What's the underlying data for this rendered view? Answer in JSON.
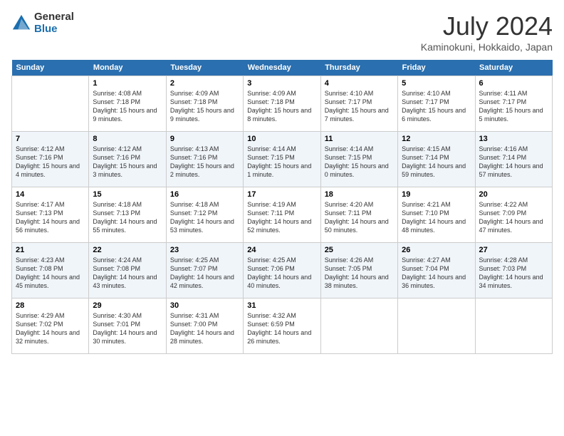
{
  "header": {
    "logo_general": "General",
    "logo_blue": "Blue",
    "month_title": "July 2024",
    "location": "Kaminokuni, Hokkaido, Japan"
  },
  "days_of_week": [
    "Sunday",
    "Monday",
    "Tuesday",
    "Wednesday",
    "Thursday",
    "Friday",
    "Saturday"
  ],
  "weeks": [
    [
      {
        "day": "",
        "sunrise": "",
        "sunset": "",
        "daylight": ""
      },
      {
        "day": "1",
        "sunrise": "Sunrise: 4:08 AM",
        "sunset": "Sunset: 7:18 PM",
        "daylight": "Daylight: 15 hours and 9 minutes."
      },
      {
        "day": "2",
        "sunrise": "Sunrise: 4:09 AM",
        "sunset": "Sunset: 7:18 PM",
        "daylight": "Daylight: 15 hours and 9 minutes."
      },
      {
        "day": "3",
        "sunrise": "Sunrise: 4:09 AM",
        "sunset": "Sunset: 7:18 PM",
        "daylight": "Daylight: 15 hours and 8 minutes."
      },
      {
        "day": "4",
        "sunrise": "Sunrise: 4:10 AM",
        "sunset": "Sunset: 7:17 PM",
        "daylight": "Daylight: 15 hours and 7 minutes."
      },
      {
        "day": "5",
        "sunrise": "Sunrise: 4:10 AM",
        "sunset": "Sunset: 7:17 PM",
        "daylight": "Daylight: 15 hours and 6 minutes."
      },
      {
        "day": "6",
        "sunrise": "Sunrise: 4:11 AM",
        "sunset": "Sunset: 7:17 PM",
        "daylight": "Daylight: 15 hours and 5 minutes."
      }
    ],
    [
      {
        "day": "7",
        "sunrise": "Sunrise: 4:12 AM",
        "sunset": "Sunset: 7:16 PM",
        "daylight": "Daylight: 15 hours and 4 minutes."
      },
      {
        "day": "8",
        "sunrise": "Sunrise: 4:12 AM",
        "sunset": "Sunset: 7:16 PM",
        "daylight": "Daylight: 15 hours and 3 minutes."
      },
      {
        "day": "9",
        "sunrise": "Sunrise: 4:13 AM",
        "sunset": "Sunset: 7:16 PM",
        "daylight": "Daylight: 15 hours and 2 minutes."
      },
      {
        "day": "10",
        "sunrise": "Sunrise: 4:14 AM",
        "sunset": "Sunset: 7:15 PM",
        "daylight": "Daylight: 15 hours and 1 minute."
      },
      {
        "day": "11",
        "sunrise": "Sunrise: 4:14 AM",
        "sunset": "Sunset: 7:15 PM",
        "daylight": "Daylight: 15 hours and 0 minutes."
      },
      {
        "day": "12",
        "sunrise": "Sunrise: 4:15 AM",
        "sunset": "Sunset: 7:14 PM",
        "daylight": "Daylight: 14 hours and 59 minutes."
      },
      {
        "day": "13",
        "sunrise": "Sunrise: 4:16 AM",
        "sunset": "Sunset: 7:14 PM",
        "daylight": "Daylight: 14 hours and 57 minutes."
      }
    ],
    [
      {
        "day": "14",
        "sunrise": "Sunrise: 4:17 AM",
        "sunset": "Sunset: 7:13 PM",
        "daylight": "Daylight: 14 hours and 56 minutes."
      },
      {
        "day": "15",
        "sunrise": "Sunrise: 4:18 AM",
        "sunset": "Sunset: 7:13 PM",
        "daylight": "Daylight: 14 hours and 55 minutes."
      },
      {
        "day": "16",
        "sunrise": "Sunrise: 4:18 AM",
        "sunset": "Sunset: 7:12 PM",
        "daylight": "Daylight: 14 hours and 53 minutes."
      },
      {
        "day": "17",
        "sunrise": "Sunrise: 4:19 AM",
        "sunset": "Sunset: 7:11 PM",
        "daylight": "Daylight: 14 hours and 52 minutes."
      },
      {
        "day": "18",
        "sunrise": "Sunrise: 4:20 AM",
        "sunset": "Sunset: 7:11 PM",
        "daylight": "Daylight: 14 hours and 50 minutes."
      },
      {
        "day": "19",
        "sunrise": "Sunrise: 4:21 AM",
        "sunset": "Sunset: 7:10 PM",
        "daylight": "Daylight: 14 hours and 48 minutes."
      },
      {
        "day": "20",
        "sunrise": "Sunrise: 4:22 AM",
        "sunset": "Sunset: 7:09 PM",
        "daylight": "Daylight: 14 hours and 47 minutes."
      }
    ],
    [
      {
        "day": "21",
        "sunrise": "Sunrise: 4:23 AM",
        "sunset": "Sunset: 7:08 PM",
        "daylight": "Daylight: 14 hours and 45 minutes."
      },
      {
        "day": "22",
        "sunrise": "Sunrise: 4:24 AM",
        "sunset": "Sunset: 7:08 PM",
        "daylight": "Daylight: 14 hours and 43 minutes."
      },
      {
        "day": "23",
        "sunrise": "Sunrise: 4:25 AM",
        "sunset": "Sunset: 7:07 PM",
        "daylight": "Daylight: 14 hours and 42 minutes."
      },
      {
        "day": "24",
        "sunrise": "Sunrise: 4:25 AM",
        "sunset": "Sunset: 7:06 PM",
        "daylight": "Daylight: 14 hours and 40 minutes."
      },
      {
        "day": "25",
        "sunrise": "Sunrise: 4:26 AM",
        "sunset": "Sunset: 7:05 PM",
        "daylight": "Daylight: 14 hours and 38 minutes."
      },
      {
        "day": "26",
        "sunrise": "Sunrise: 4:27 AM",
        "sunset": "Sunset: 7:04 PM",
        "daylight": "Daylight: 14 hours and 36 minutes."
      },
      {
        "day": "27",
        "sunrise": "Sunrise: 4:28 AM",
        "sunset": "Sunset: 7:03 PM",
        "daylight": "Daylight: 14 hours and 34 minutes."
      }
    ],
    [
      {
        "day": "28",
        "sunrise": "Sunrise: 4:29 AM",
        "sunset": "Sunset: 7:02 PM",
        "daylight": "Daylight: 14 hours and 32 minutes."
      },
      {
        "day": "29",
        "sunrise": "Sunrise: 4:30 AM",
        "sunset": "Sunset: 7:01 PM",
        "daylight": "Daylight: 14 hours and 30 minutes."
      },
      {
        "day": "30",
        "sunrise": "Sunrise: 4:31 AM",
        "sunset": "Sunset: 7:00 PM",
        "daylight": "Daylight: 14 hours and 28 minutes."
      },
      {
        "day": "31",
        "sunrise": "Sunrise: 4:32 AM",
        "sunset": "Sunset: 6:59 PM",
        "daylight": "Daylight: 14 hours and 26 minutes."
      },
      {
        "day": "",
        "sunrise": "",
        "sunset": "",
        "daylight": ""
      },
      {
        "day": "",
        "sunrise": "",
        "sunset": "",
        "daylight": ""
      },
      {
        "day": "",
        "sunrise": "",
        "sunset": "",
        "daylight": ""
      }
    ]
  ]
}
